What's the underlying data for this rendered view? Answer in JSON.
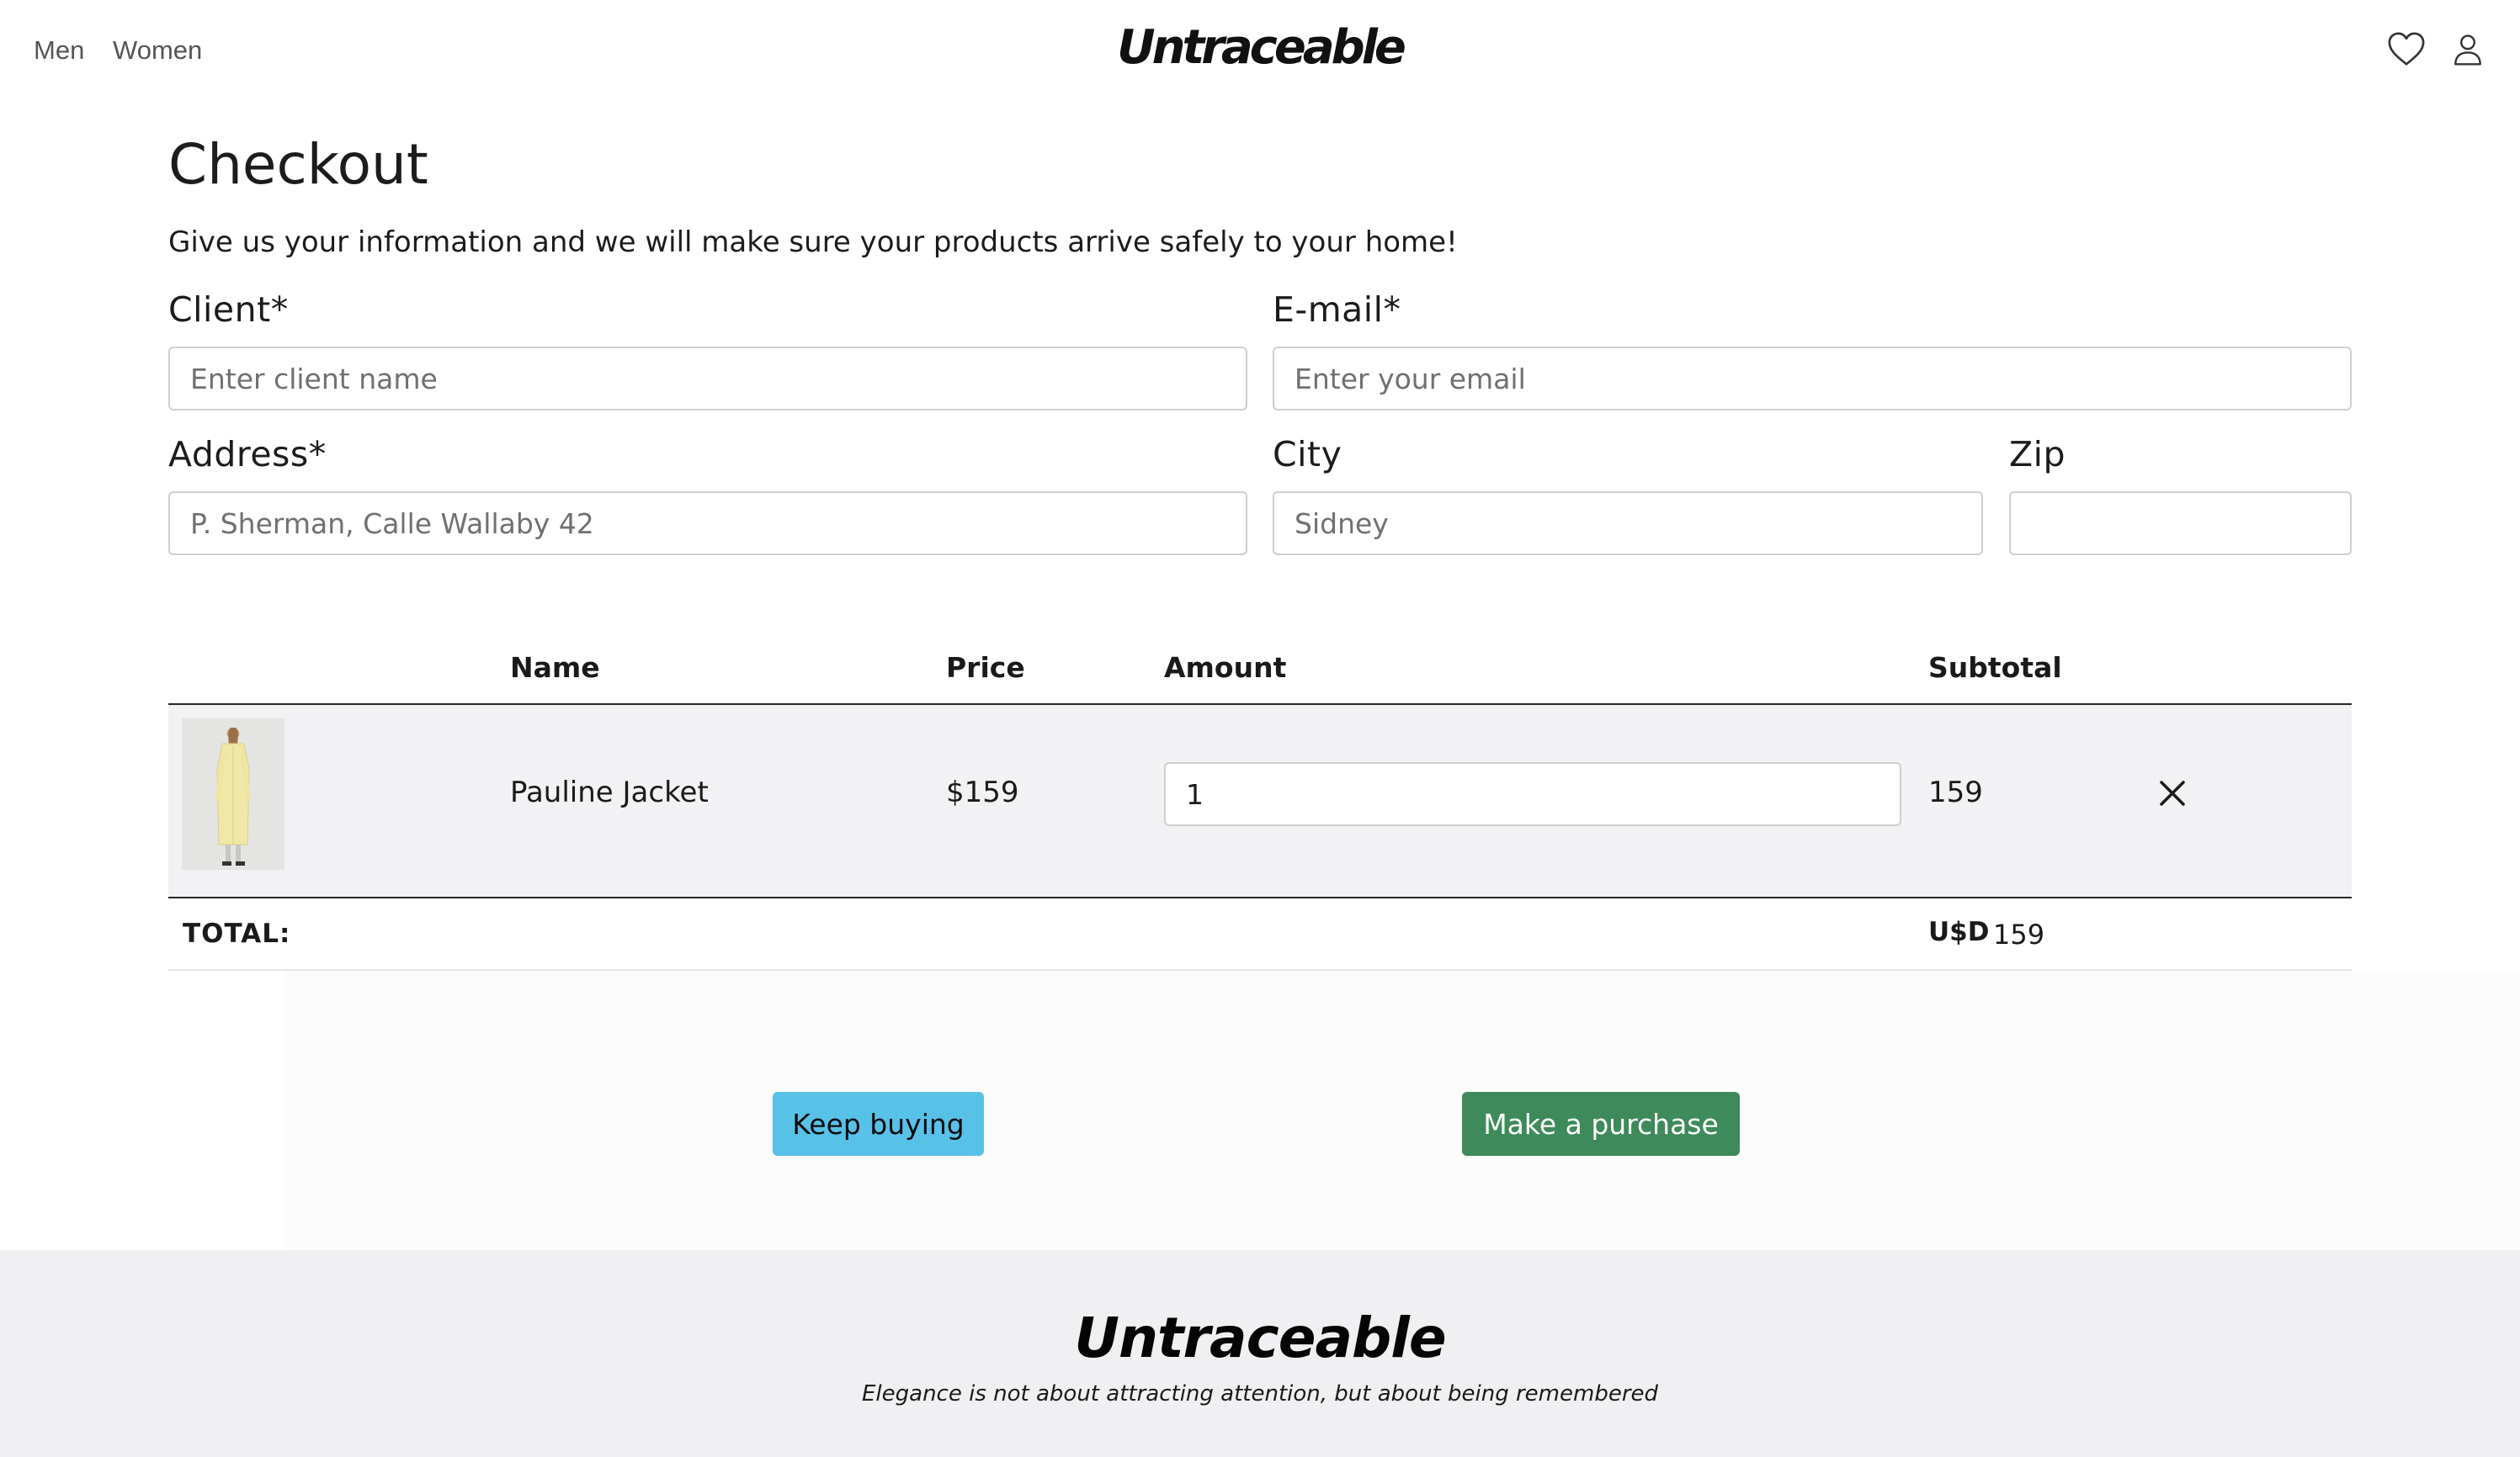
{
  "header": {
    "nav": [
      "Men",
      "Women"
    ],
    "brand": "Untraceable",
    "icons": [
      "heart-icon",
      "user-icon"
    ]
  },
  "checkout": {
    "title": "Checkout",
    "subtitle": "Give us your information and we will make sure your products arrive safely to your home!",
    "fields": {
      "client": {
        "label": "Client*",
        "placeholder": "Enter client name",
        "value": ""
      },
      "email": {
        "label": "E-mail*",
        "placeholder": "Enter your email",
        "value": ""
      },
      "address": {
        "label": "Address*",
        "placeholder": "P. Sherman, Calle Wallaby 42",
        "value": ""
      },
      "city": {
        "label": "City",
        "placeholder": "Sidney",
        "value": ""
      },
      "zip": {
        "label": "Zip",
        "placeholder": "",
        "value": ""
      }
    }
  },
  "cart": {
    "columns": [
      "Name",
      "Price",
      "Amount",
      "Subtotal"
    ],
    "items": [
      {
        "name": "Pauline Jacket",
        "price": "$159",
        "amount": "1",
        "subtotal": "159",
        "image": "yellow long coat on model"
      }
    ],
    "total_label": "TOTAL:",
    "total_currency": "U$D",
    "total_value": "159"
  },
  "actions": {
    "keep_buying": "Keep buying",
    "purchase": "Make a purchase"
  },
  "footer": {
    "brand": "Untraceable",
    "tagline": "Elegance is not about attracting attention, but about being remembered"
  },
  "colors": {
    "keep_buying_button": "#57c1e8",
    "purchase_button": "#3e8a5a",
    "row_background": "#f2f1f3",
    "footer_background": "#f0eff1"
  }
}
